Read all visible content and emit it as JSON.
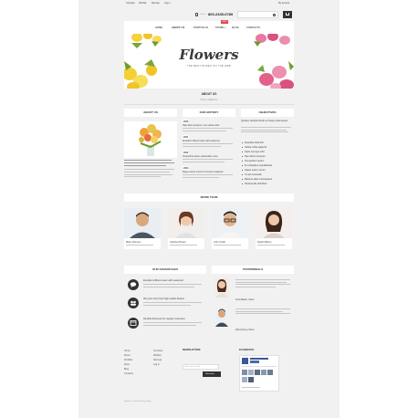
{
  "topbar": {
    "links": [
      "Compare",
      "Wishlist",
      "Sitemap",
      "Log in"
    ],
    "phone_label": "Call us:",
    "phone": "800-2345-6789",
    "account": "My account"
  },
  "nav": {
    "items": [
      "HOME",
      "ABOUT US",
      "PORTFOLIO",
      "STORE",
      "BLOG",
      "CONTACTS"
    ],
    "active_index": 1,
    "badge": "NEW"
  },
  "hero": {
    "title": "Flowers",
    "subtitle": "THE BEST ROSES ON THE WEB"
  },
  "breadcrumb": {
    "title": "ABOUT US",
    "trail": "Home / About Us"
  },
  "sections": {
    "about": "ABOUT US",
    "history": "OUR HISTORY",
    "objectives": "OBJECTIVES",
    "team": "WORK TEAM",
    "advantages": "OUR ADVANTAGES",
    "testimonials": "TESTIMONIALS"
  },
  "history": {
    "years": [
      "2010",
      "2011",
      "2012",
      "2013"
    ],
    "items": [
      "Nam libero tempore, cum soluta nobis",
      "Excellent efficient team with seasoned",
      "Temporibus autem quibusdam et aut",
      "Itaque earum rerum hic tenetur a sapiente"
    ]
  },
  "objectives": {
    "intro": "Quisque volutpat lobortis et integer pellentesque",
    "items": [
      "Expedita distinctio",
      "Soluta nobis eligendi",
      "Optio cumque nihil",
      "Nam libero tempore",
      "Temporibus autem",
      "Et voluptates repudiandae",
      "Itaque earum rerum",
      "Ut aut reiciendis",
      "Maiores alias consequatur",
      "Perferendis doloribus"
    ]
  },
  "team": [
    {
      "name": "Mark Johnson"
    },
    {
      "name": "Caroline Brown"
    },
    {
      "name": "John Smith"
    },
    {
      "name": "Sarah Wilson"
    }
  ],
  "advantages": [
    "Excellent efficient team with seasoned",
    "We grow only fresh high quality flowers",
    "Flexible discounts for regular customers"
  ],
  "testimonials": [
    {
      "name": "Anna Martin, Client"
    },
    {
      "name": "Nick Grimes, Client"
    }
  ],
  "footer": {
    "col1": [
      "Home",
      "About",
      "Portfolio",
      "Store",
      "Blog",
      "Contacts"
    ],
    "col2": [
      "Compare",
      "Wishlist",
      "Sitemap",
      "Log in"
    ],
    "newsletter_title": "NEWSLETTER:",
    "newsletter_placeholder": "Enter your e-mail",
    "subscribe_label": "Subscribe",
    "facebook_title": "FACEBOOK:",
    "copyright": "Flowers © 2014 Privacy Policy"
  },
  "colors": {
    "accent": "#e5444a",
    "dark": "#333333",
    "page_bg": "#f1f1f1"
  }
}
